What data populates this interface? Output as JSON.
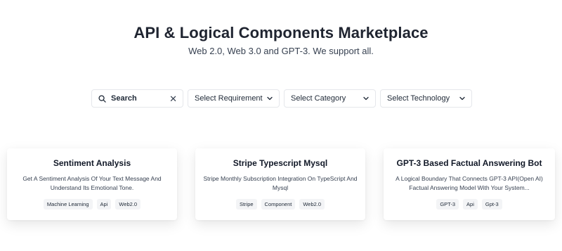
{
  "header": {
    "title": "API & Logical Components Marketplace",
    "subtitle": "Web 2.0, Web 3.0 and GPT-3. We support all."
  },
  "filters": {
    "search_label": "Search",
    "clear_symbol": "✕",
    "requirement_label": "Select Requirement",
    "category_label": "Select Category",
    "technology_label": "Select Technology"
  },
  "cards": [
    {
      "title": "Sentiment Analysis",
      "description": "Get A Sentiment Analysis Of Your Text Message And Understand Its Emotional Tone.",
      "tags": [
        "Machine Learning",
        "Api",
        "Web2.0"
      ]
    },
    {
      "title": "Stripe Typescript Mysql",
      "description": "Stripe Monthly Subscription Integration On TypeScript And Mysql",
      "tags": [
        "Stripe",
        "Component",
        "Web2.0"
      ]
    },
    {
      "title": "GPT-3 Based Factual Answering Bot",
      "description": "A Logical Boundary That Connects GPT-3 API(Open AI) Factual Answering Model With Your System...",
      "tags": [
        "GPT-3",
        "Api",
        "Gpt-3"
      ]
    }
  ],
  "icons": {
    "search": "search-icon",
    "clear": "close-icon",
    "dropdown": "chevron-down-icon"
  }
}
